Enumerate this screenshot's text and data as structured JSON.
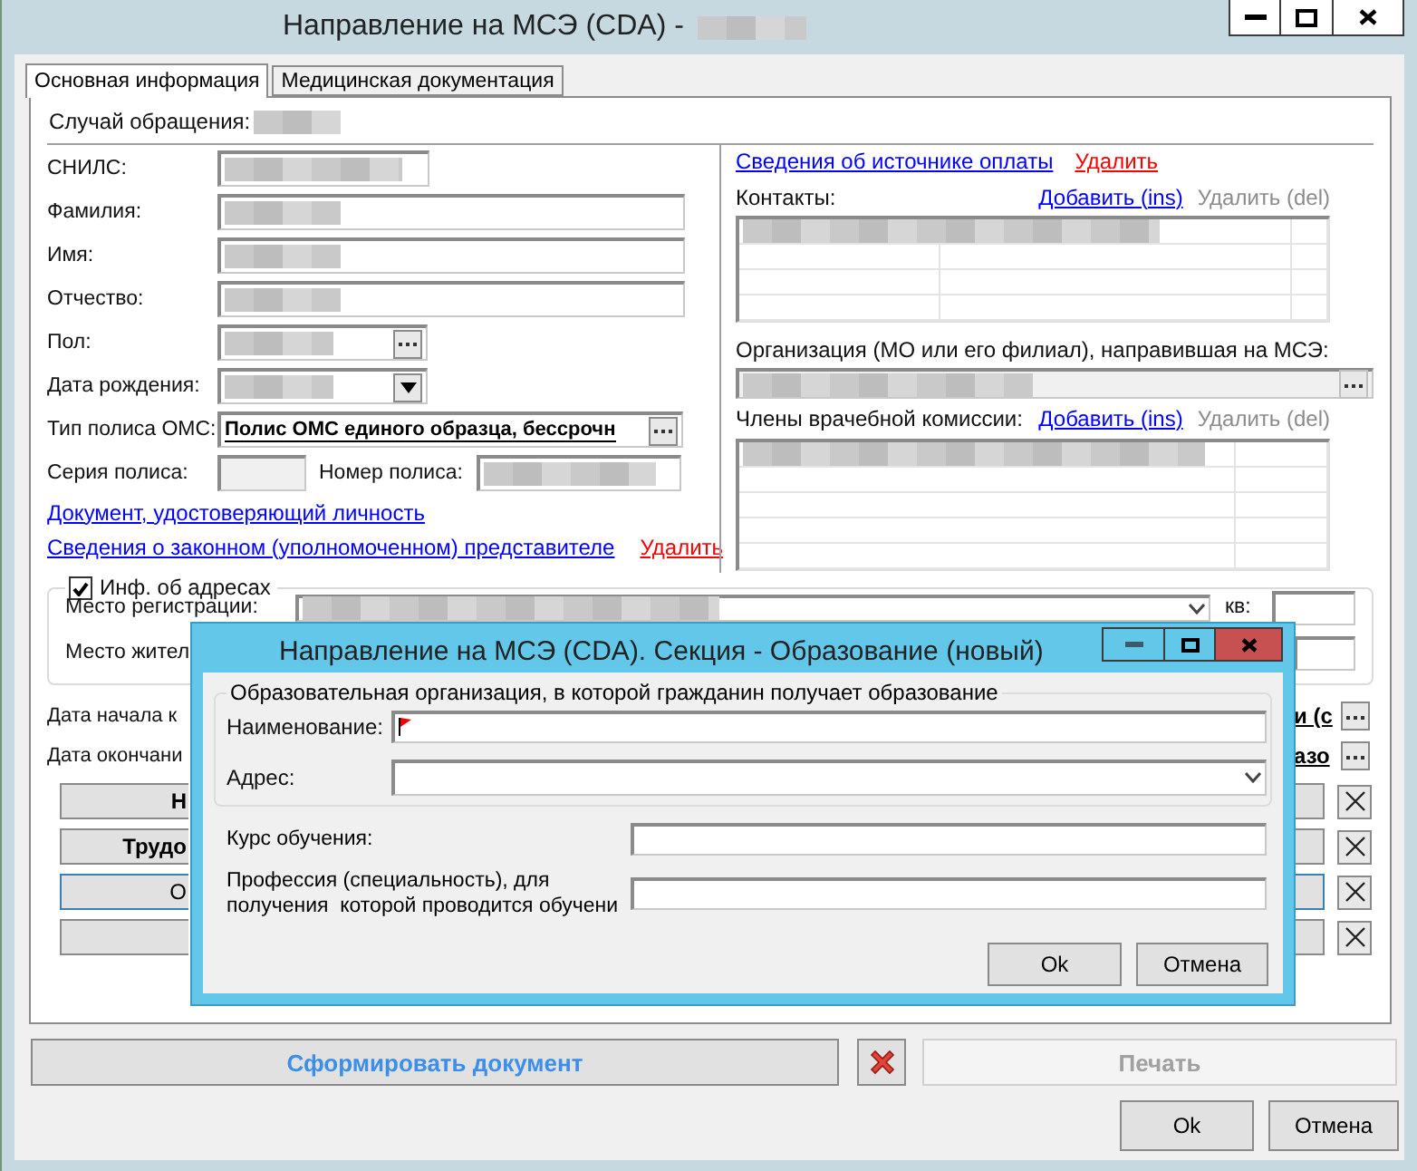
{
  "window": {
    "title": "Направление на МСЭ (CDA) -",
    "redacted": true
  },
  "tabs": [
    {
      "label": "Основная информация",
      "selected": true
    },
    {
      "label": "Медицинская документация",
      "selected": false
    }
  ],
  "case": {
    "label": "Случай обращения:",
    "redacted": true
  },
  "person": [
    {
      "label": "СНИЛС:",
      "kind": "short",
      "redacted": true
    },
    {
      "label": "Фамилия:",
      "kind": "long",
      "redacted": true
    },
    {
      "label": "Имя:",
      "kind": "long",
      "redacted": true
    },
    {
      "label": "Отчество:",
      "kind": "long",
      "redacted": true
    },
    {
      "label": "Пол:",
      "kind": "picker",
      "redacted": true
    },
    {
      "label": "Дата рождения:",
      "kind": "dropdown",
      "redacted": true
    },
    {
      "label": "Тип полиса ОМС:",
      "kind": "picker_wide",
      "value": "Полис ОМС единого образца, бессрочн"
    }
  ],
  "policy": {
    "series_label": "Серия полиса:",
    "number_label": "Номер полиса:",
    "number_redacted": true
  },
  "identity_link": "Документ, удостоверяющий личность",
  "representative": {
    "link": "Сведения о законном (уполномоченном) представителе",
    "delete": "Удалить"
  },
  "payment": {
    "link": "Сведения об источнике оплаты",
    "delete": "Удалить"
  },
  "contacts": {
    "label": "Контакты:",
    "add": "Добавить (ins)",
    "remove": "Удалить (del)",
    "remove_disabled": true,
    "redacted": true
  },
  "organization": {
    "label": "Организация (МО или его филиал), направившая на МСЭ:",
    "redacted": true
  },
  "commission": {
    "label": "Члены врачебной комиссии:",
    "add": "Добавить (ins)",
    "remove": "Удалить (del)",
    "remove_disabled": true,
    "redacted": true
  },
  "addresses": {
    "label": "Инф. об адресах",
    "checked": true,
    "registration_label": "Место регистрации:",
    "registration_redacted": true,
    "apartment_label": "кв:",
    "residence_label": "Место жител"
  },
  "dates": [
    {
      "label": "Дата начала к",
      "value": "и (с"
    },
    {
      "label": "Дата окончани",
      "value": "азо"
    }
  ],
  "sections": [
    {
      "label": "Н",
      "bold": true,
      "focused": false
    },
    {
      "label": "Трудо",
      "bold": true,
      "focused": false
    },
    {
      "label": "О",
      "bold": false,
      "focused": true
    },
    {
      "focused": false
    }
  ],
  "dialog": {
    "title": "Направление на МСЭ (CDA). Секция - Образование (новый)",
    "group": "Образовательная организация, в которой гражданин получает образование",
    "fields": [
      {
        "label": "Наименование:",
        "kind": "text",
        "required": true
      },
      {
        "label": "Адрес:",
        "kind": "dropdown",
        "required": false
      }
    ],
    "study": [
      {
        "label": "Курс обучения:"
      },
      {
        "label": "Профессия (специальность), для получения  которой проводится обучени"
      }
    ],
    "ok": "Ok",
    "cancel": "Отмена"
  },
  "footer": {
    "generate": "Сформировать документ",
    "print": "Печать",
    "print_disabled": true,
    "ok": "Ok",
    "cancel": "Отмена"
  }
}
